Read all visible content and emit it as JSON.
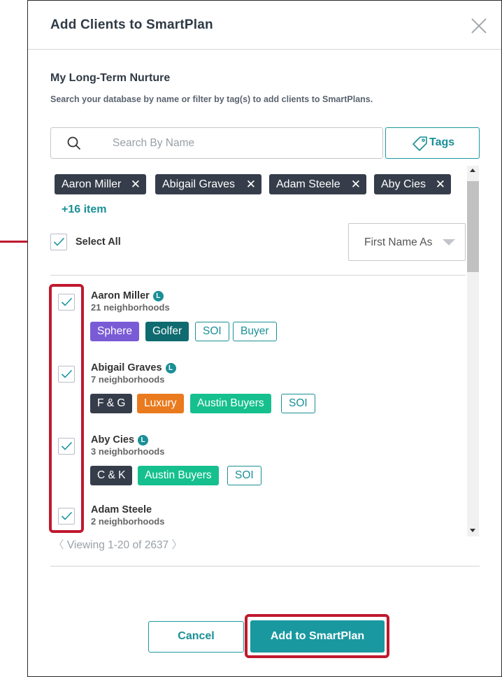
{
  "dialog": {
    "title": "Add Clients to SmartPlan",
    "section_title": "My Long-Term Nurture",
    "section_subtitle": "Search your database by name or filter by tag(s) to add clients to SmartPlans."
  },
  "search": {
    "placeholder": "Search By Name",
    "value": ""
  },
  "tags_button": {
    "label": "Tags"
  },
  "selected_chips": [
    {
      "label": "Aaron Miller"
    },
    {
      "label": "Abigail Graves"
    },
    {
      "label": "Adam Steele"
    },
    {
      "label": "Aby Cies"
    }
  ],
  "more_items_label": "+16 item",
  "select_all": {
    "label": "Select All",
    "checked": true
  },
  "sort": {
    "value": "First Name As"
  },
  "clients": [
    {
      "name": "Aaron Miller",
      "badge": "L",
      "sub": "21 neighborhoods",
      "checked": true,
      "tags": [
        {
          "label": "Sphere",
          "color": "#7a5bd6",
          "style": "filled"
        },
        {
          "label": "Golfer",
          "color": "#0f6b70",
          "style": "filled"
        },
        {
          "label": "SOI",
          "color": "#1a8f96",
          "style": "outline"
        },
        {
          "label": "Buyer",
          "color": "#1a8f96",
          "style": "outline"
        }
      ]
    },
    {
      "name": "Abigail Graves",
      "badge": "L",
      "sub": "7 neighborhoods",
      "checked": true,
      "tags": [
        {
          "label": "F & G",
          "color": "#363d4a",
          "style": "filled"
        },
        {
          "label": "Luxury",
          "color": "#ea7a1e",
          "style": "filled"
        },
        {
          "label": "Austin Buyers",
          "color": "#15c08e",
          "style": "filled"
        },
        {
          "label": "SOI",
          "color": "#1a8f96",
          "style": "outline"
        }
      ]
    },
    {
      "name": "Aby Cies",
      "badge": "L",
      "sub": "3 neighborhoods",
      "checked": true,
      "tags": [
        {
          "label": "C & K",
          "color": "#363d4a",
          "style": "filled"
        },
        {
          "label": "Austin Buyers",
          "color": "#15c08e",
          "style": "filled"
        },
        {
          "label": "SOI",
          "color": "#1a8f96",
          "style": "outline"
        }
      ]
    },
    {
      "name": "Adam Steele",
      "badge": "",
      "sub": "2 neighborhoods",
      "checked": true,
      "tags": []
    }
  ],
  "pager": {
    "text": "Viewing 1-20 of 2637",
    "prev": "〈",
    "next": "〉"
  },
  "buttons": {
    "cancel": "Cancel",
    "add": "Add to SmartPlan"
  },
  "colors": {
    "accent": "#1a98a0",
    "annotation": "#c0192e",
    "chip": "#363d4a"
  }
}
